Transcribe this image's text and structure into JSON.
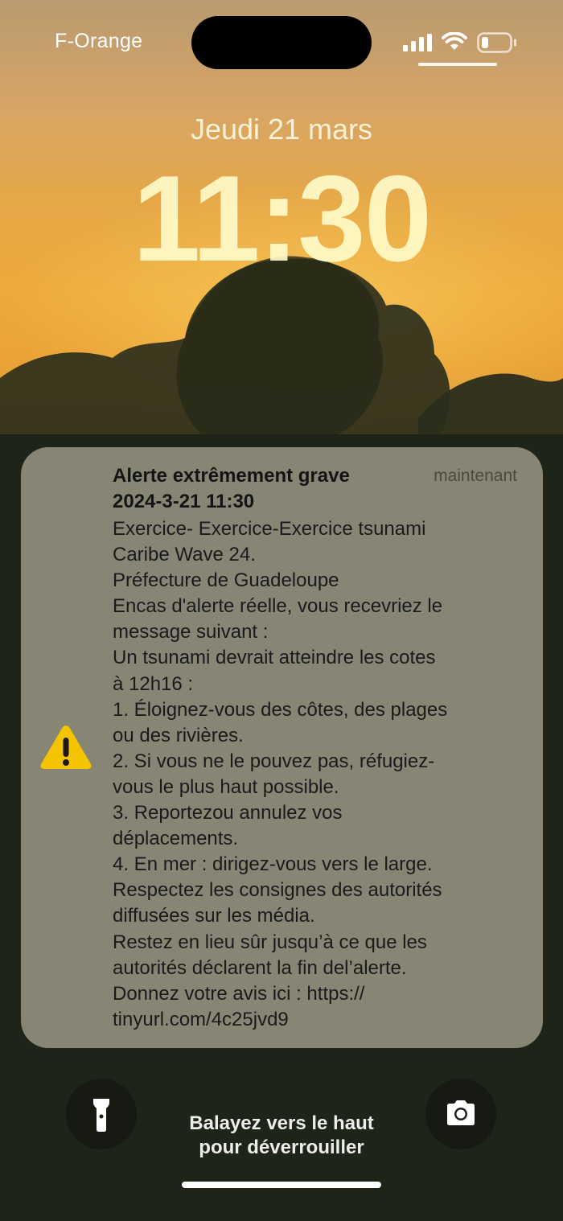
{
  "status_bar": {
    "carrier": "F-Orange",
    "signal_icon": "cellular-signal-icon",
    "wifi_icon": "wifi-icon",
    "battery_icon": "battery-icon",
    "battery_level": 0.2
  },
  "lock_screen": {
    "date": "Jeudi 21 mars",
    "time": "11:30"
  },
  "notification": {
    "icon": "warning-icon",
    "icon_color": "#f5c400",
    "title": "Alerte extrêmement grave",
    "time": "maintenant",
    "date_line": "2024-3-21 11:30",
    "body_lines": [
      "Exercice- Exercice-Exercice tsunami",
      "Caribe Wave 24.",
      "Préfecture de Guadeloupe",
      "Encas d'alerte réelle, vous recevriez le",
      "message suivant :",
      "Un tsunami devrait atteindre les cotes",
      "à 12h16 :",
      "1. Éloignez-vous des côtes, des plages",
      "ou des rivières.",
      "2. Si vous ne le pouvez pas, réfugiez-",
      "vous le plus haut possible.",
      "3. Reportezou annulez vos",
      "déplacements.",
      "4. En mer : dirigez-vous vers le large.",
      "Respectez les consignes des autorités",
      "diffusées sur les média.",
      "Restez en lieu sûr jusqu’à ce que les",
      "autorités déclarent la fin del’alerte.",
      "Donnez votre avis ici : https://",
      "tinyurl.com/4c25jvd9"
    ]
  },
  "bottom": {
    "flashlight_icon": "flashlight-icon",
    "camera_icon": "camera-icon",
    "unlock_line1": "Balayez vers le haut",
    "unlock_line2": "pour déverrouiller"
  }
}
